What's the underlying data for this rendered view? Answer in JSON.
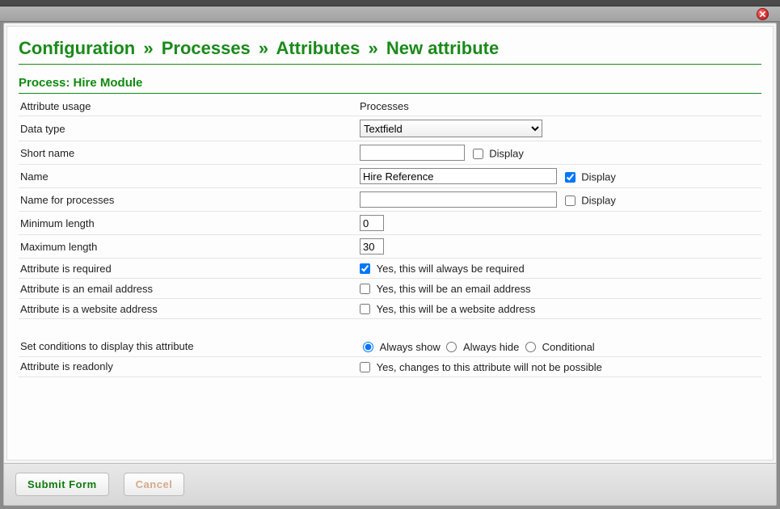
{
  "breadcrumb": {
    "a": "Configuration",
    "b": "Processes",
    "c": "Attributes",
    "d": "New attribute"
  },
  "subheading": "Process: Hire Module",
  "labels": {
    "attribute_usage": "Attribute usage",
    "data_type": "Data type",
    "short_name": "Short name",
    "name": "Name",
    "name_for_processes": "Name for processes",
    "min_length": "Minimum length",
    "max_length": "Maximum length",
    "required": "Attribute is required",
    "is_email": "Attribute is an email address",
    "is_website": "Attribute is a website address",
    "conditions": "Set conditions to display this attribute",
    "readonly": "Attribute is readonly"
  },
  "values": {
    "attribute_usage": "Processes",
    "data_type_selected": "Textfield",
    "short_name": "",
    "name": "Hire Reference",
    "name_for_processes": "",
    "min_length": "0",
    "max_length": "30"
  },
  "checkbox_text": {
    "display": "Display",
    "required": "Yes, this will always be required",
    "is_email": "Yes, this will be an email address",
    "is_website": "Yes, this will be a website address",
    "readonly": "Yes, changes to this attribute will not be possible"
  },
  "radio_text": {
    "always_show": "Always show",
    "always_hide": "Always hide",
    "conditional": "Conditional"
  },
  "buttons": {
    "submit": "Submit Form",
    "cancel": "Cancel"
  },
  "colors": {
    "accent_green": "#1a8a1a"
  }
}
